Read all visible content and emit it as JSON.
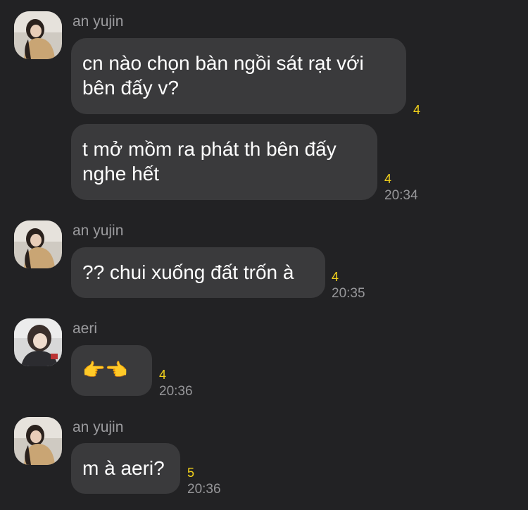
{
  "colors": {
    "background": "#222224",
    "bubble": "#3a3a3c",
    "sender_name": "#9b9b9e",
    "timestamp": "#97979a",
    "unread_count": "#f2d11b"
  },
  "messages": [
    {
      "sender": "an yujin",
      "avatar": "profile-photo-an-yujin",
      "bubbles": [
        {
          "text": "cn nào chọn bàn ngồi sát rạt với\nbên đấy v?",
          "unread": "4",
          "time": ""
        },
        {
          "text": "t mở mồm ra phát th bên đấy\nnghe hết",
          "unread": "4",
          "time": "20:34"
        }
      ]
    },
    {
      "sender": "an yujin",
      "avatar": "profile-photo-an-yujin",
      "bubbles": [
        {
          "text": "?? chui xuống đất trốn à",
          "unread": "4",
          "time": "20:35"
        }
      ]
    },
    {
      "sender": "aeri",
      "avatar": "profile-photo-aeri",
      "bubbles": [
        {
          "text": "",
          "emoji": "👉👈",
          "unread": "4",
          "time": "20:36"
        }
      ]
    },
    {
      "sender": "an yujin",
      "avatar": "profile-photo-an-yujin",
      "bubbles": [
        {
          "text": "m à aeri?",
          "unread": "5",
          "time": "20:36"
        }
      ]
    }
  ]
}
